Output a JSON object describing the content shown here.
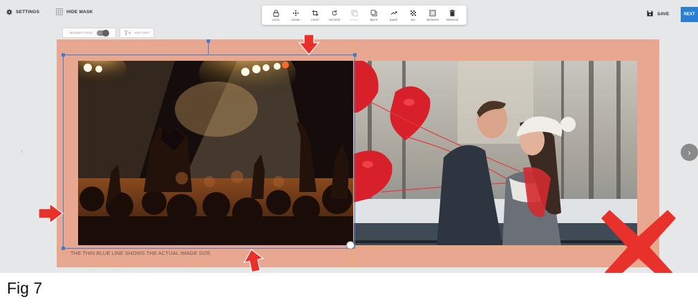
{
  "topbar": {
    "settings_label": "SETTINGS",
    "hide_mask_label": "HIDE MASK",
    "save_label": "SAVE",
    "next_label": "NEXT"
  },
  "toolbar": {
    "tools": [
      {
        "label": "LOCK",
        "icon": "lock-icon"
      },
      {
        "label": "ZOOM",
        "icon": "zoom-icon"
      },
      {
        "label": "CROP",
        "icon": "crop-icon"
      },
      {
        "label": "ROTATE",
        "icon": "rotate-icon"
      },
      {
        "label": "FRONT",
        "icon": "front-icon"
      },
      {
        "label": "BACK",
        "icon": "back-icon"
      },
      {
        "label": "SWAP",
        "icon": "swap-icon"
      },
      {
        "label": "BG",
        "icon": "bg-icon"
      },
      {
        "label": "BORDER",
        "icon": "border-icon"
      },
      {
        "label": "REMOVE",
        "icon": "trash-icon"
      }
    ]
  },
  "subtools": {
    "magnify_label": "MAGNIFY TOOL",
    "add_text_label": "ADD TEXT"
  },
  "canvas": {
    "caption": "THE THIN BLUE LINE SHOWS THE ACTUAL IMAGE SIZE",
    "left_photo": "concert-crowd-photo",
    "right_photo": "couple-with-heart-balloons-photo"
  },
  "figure_label": "Fig 7",
  "colors": {
    "spread_bg": "#e8a78f",
    "selection": "#3d7bd6",
    "guide": "#f2b646",
    "next_button": "#2a7fd4",
    "annotation_red": "#e8312a"
  }
}
